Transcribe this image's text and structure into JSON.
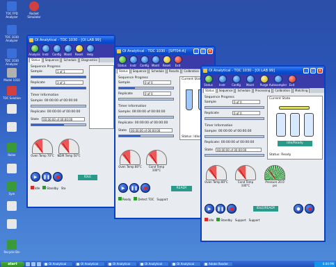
{
  "desktop_icons": [
    {
      "label": "TOC FPD Analyzer",
      "color": "#3a6fd8"
    },
    {
      "label": "Rocket Simulator",
      "color": "#d04040"
    },
    {
      "label": "TOC 1030 Analyzer",
      "color": "#3a6fd8"
    },
    {
      "label": "TOC 1030 Analyzer",
      "color": "#3a6fd8"
    },
    {
      "label": "Model 1010",
      "color": "#b0b0b0"
    },
    {
      "label": "TOC Solution",
      "color": "#d04040"
    },
    {
      "label": "",
      "color": "#e8e8e8"
    },
    {
      "label": "",
      "color": "#e8e8e8"
    },
    {
      "label": "Roller",
      "color": "#3a9a3a"
    },
    {
      "label": "",
      "color": "#e8e8e8"
    },
    {
      "label": "Sym",
      "color": "#3a9a3a"
    },
    {
      "label": "",
      "color": "#e8e8e8"
    },
    {
      "label": "",
      "color": "#e8e8e8"
    },
    {
      "label": "Recycle Bin",
      "color": "#3a9a3a"
    }
  ],
  "windows": [
    {
      "title": "OI Analytical - TOC 1030 - [OI LAB 99]",
      "tools": [
        "Analysis",
        "Instr",
        "Config",
        "Maint",
        "Reset",
        "Help"
      ],
      "tabs": [
        "Status",
        "Sequence",
        "Schedule",
        "Diagnostics",
        "Results"
      ],
      "sequence_label": "Sequence Progress",
      "sample_label": "Sample",
      "sample_value": "1 of 1",
      "replicate_label": "Replicate",
      "replicate_value": "3 of 3",
      "timer_label": "Timer Information",
      "timer_row1": "Sample: 00:00:00 of 00:00:00",
      "timer_row2": "Replicate: 00:00:00 of 00:00:00",
      "state_label": "State",
      "state_value": "00:00:00 of 00:00:00",
      "gauge1": "Oven Temp 70°C",
      "gauge2": "NDIR Temp 50°C",
      "status_text": "IDLE",
      "footer1": "Idle",
      "footer2": "Standby",
      "footer3": "Sta"
    },
    {
      "title": "OI Analytical - TOC 1030 - [SPT04-A]",
      "tools": [
        "Status",
        "Instr",
        "Config",
        "Maint",
        "Reset",
        "Exit"
      ],
      "tabs": [
        "Status",
        "Sequence",
        "Schedule",
        "Results",
        "Calibration"
      ],
      "sequence_label": "Sequence Progress",
      "sample_label": "Sample",
      "sample_value": "0 of 0",
      "replicate_label": "Replicate",
      "replicate_value": "0 of 0",
      "timer_label": "Timer Information",
      "timer_row1": "Sample: 00:00:00 of 00:00:00",
      "timer_row2": "Replicate: 00:00:00 of 00:00:00",
      "state_label": "State",
      "state_value": "00:00:00 of 00:00:00",
      "diagram_label": "Current State",
      "diagram_footer": "Status: Idle/Ready",
      "gauge1": "Oven Temp 80°C",
      "gauge2": "Cond Temp 100°C",
      "status_text": "READY",
      "footer1": "Ready",
      "footer2": "Detect TOC",
      "footer3": "Support"
    },
    {
      "title": "OI Analytical - TOC 1030 - [OI LAB 99]",
      "tools": [
        "Status",
        "Instr",
        "Config",
        "Maint",
        "Purge",
        "Autosampler",
        "Exit"
      ],
      "tabs": [
        "Status",
        "Sequence",
        "Schedule",
        "Processing",
        "Calibration",
        "Matching"
      ],
      "sequence_label": "Sequence Progress",
      "sample_label": "Sample",
      "sample_value": "0 of 0",
      "replicate_label": "Replicate",
      "replicate_value": "0 of 0",
      "timer_label": "Timer Information",
      "timer_row1": "Sample: 00:00:00 of 00:00:00",
      "timer_row2": "Replicate: 00:00:00 of 00:00:00",
      "state_label": "State",
      "state_value": "00:00:00 of 00:00:00",
      "diagram_label": "Current State",
      "diagram_button": "Idle/Ready",
      "diagram_footer": "Status: Ready",
      "gauge1": "Oven Temp 80°C",
      "gauge2": "Cond Temp 100°C",
      "gauge3": "Pressure 20.0 psi",
      "status_text": "IDLE/READY",
      "footer1": "Idle",
      "footer2": "Standby",
      "footer3": "Support",
      "footer4": "Support"
    }
  ],
  "taskbar": {
    "start": "start",
    "tasks": [
      "OI Analytical",
      "OI Analytical",
      "OI Analytical",
      "OI Analytical",
      "OI Analytical",
      "Adobe Reader"
    ],
    "clock": "6:00 PM"
  }
}
